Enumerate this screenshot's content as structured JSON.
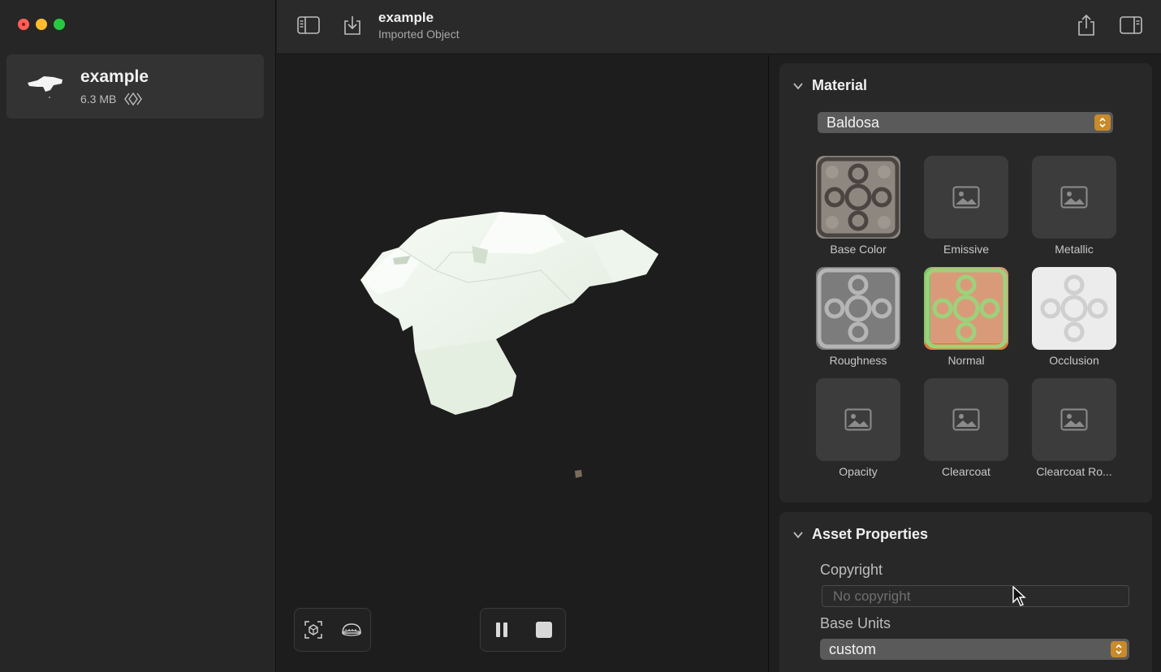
{
  "window": {
    "title": "example",
    "subtitle": "Imported Object"
  },
  "sidebar": {
    "items": [
      {
        "name": "example",
        "size": "6.3 MB",
        "badge_icon": "ar-quicklook-icon"
      }
    ]
  },
  "toolbar": {
    "icons": [
      "sidebar-toggle-icon",
      "download-icon",
      "share-icon",
      "inspector-toggle-icon"
    ]
  },
  "viewport": {
    "left_controls": [
      "focus-icon",
      "ground-plane-icon"
    ],
    "playback_controls": [
      "pause-icon",
      "stop-icon"
    ]
  },
  "material": {
    "header": "Material",
    "selected": "Baldosa",
    "textures": [
      {
        "label": "Base Color",
        "state": "filled"
      },
      {
        "label": "Emissive",
        "state": "empty"
      },
      {
        "label": "Metallic",
        "state": "empty"
      },
      {
        "label": "Roughness",
        "state": "filled"
      },
      {
        "label": "Normal",
        "state": "filled"
      },
      {
        "label": "Occlusion",
        "state": "filled"
      },
      {
        "label": "Opacity",
        "state": "empty"
      },
      {
        "label": "Clearcoat",
        "state": "empty"
      },
      {
        "label": "Clearcoat Ro...",
        "state": "empty"
      }
    ]
  },
  "asset_properties": {
    "header": "Asset Properties",
    "copyright_label": "Copyright",
    "copyright_placeholder": "No copyright",
    "base_units_label": "Base Units",
    "base_units_value": "custom"
  },
  "colors": {
    "accent": "#c98a2b",
    "close": "#ff5f57",
    "minimize": "#febc2e",
    "maximize": "#28c840"
  }
}
